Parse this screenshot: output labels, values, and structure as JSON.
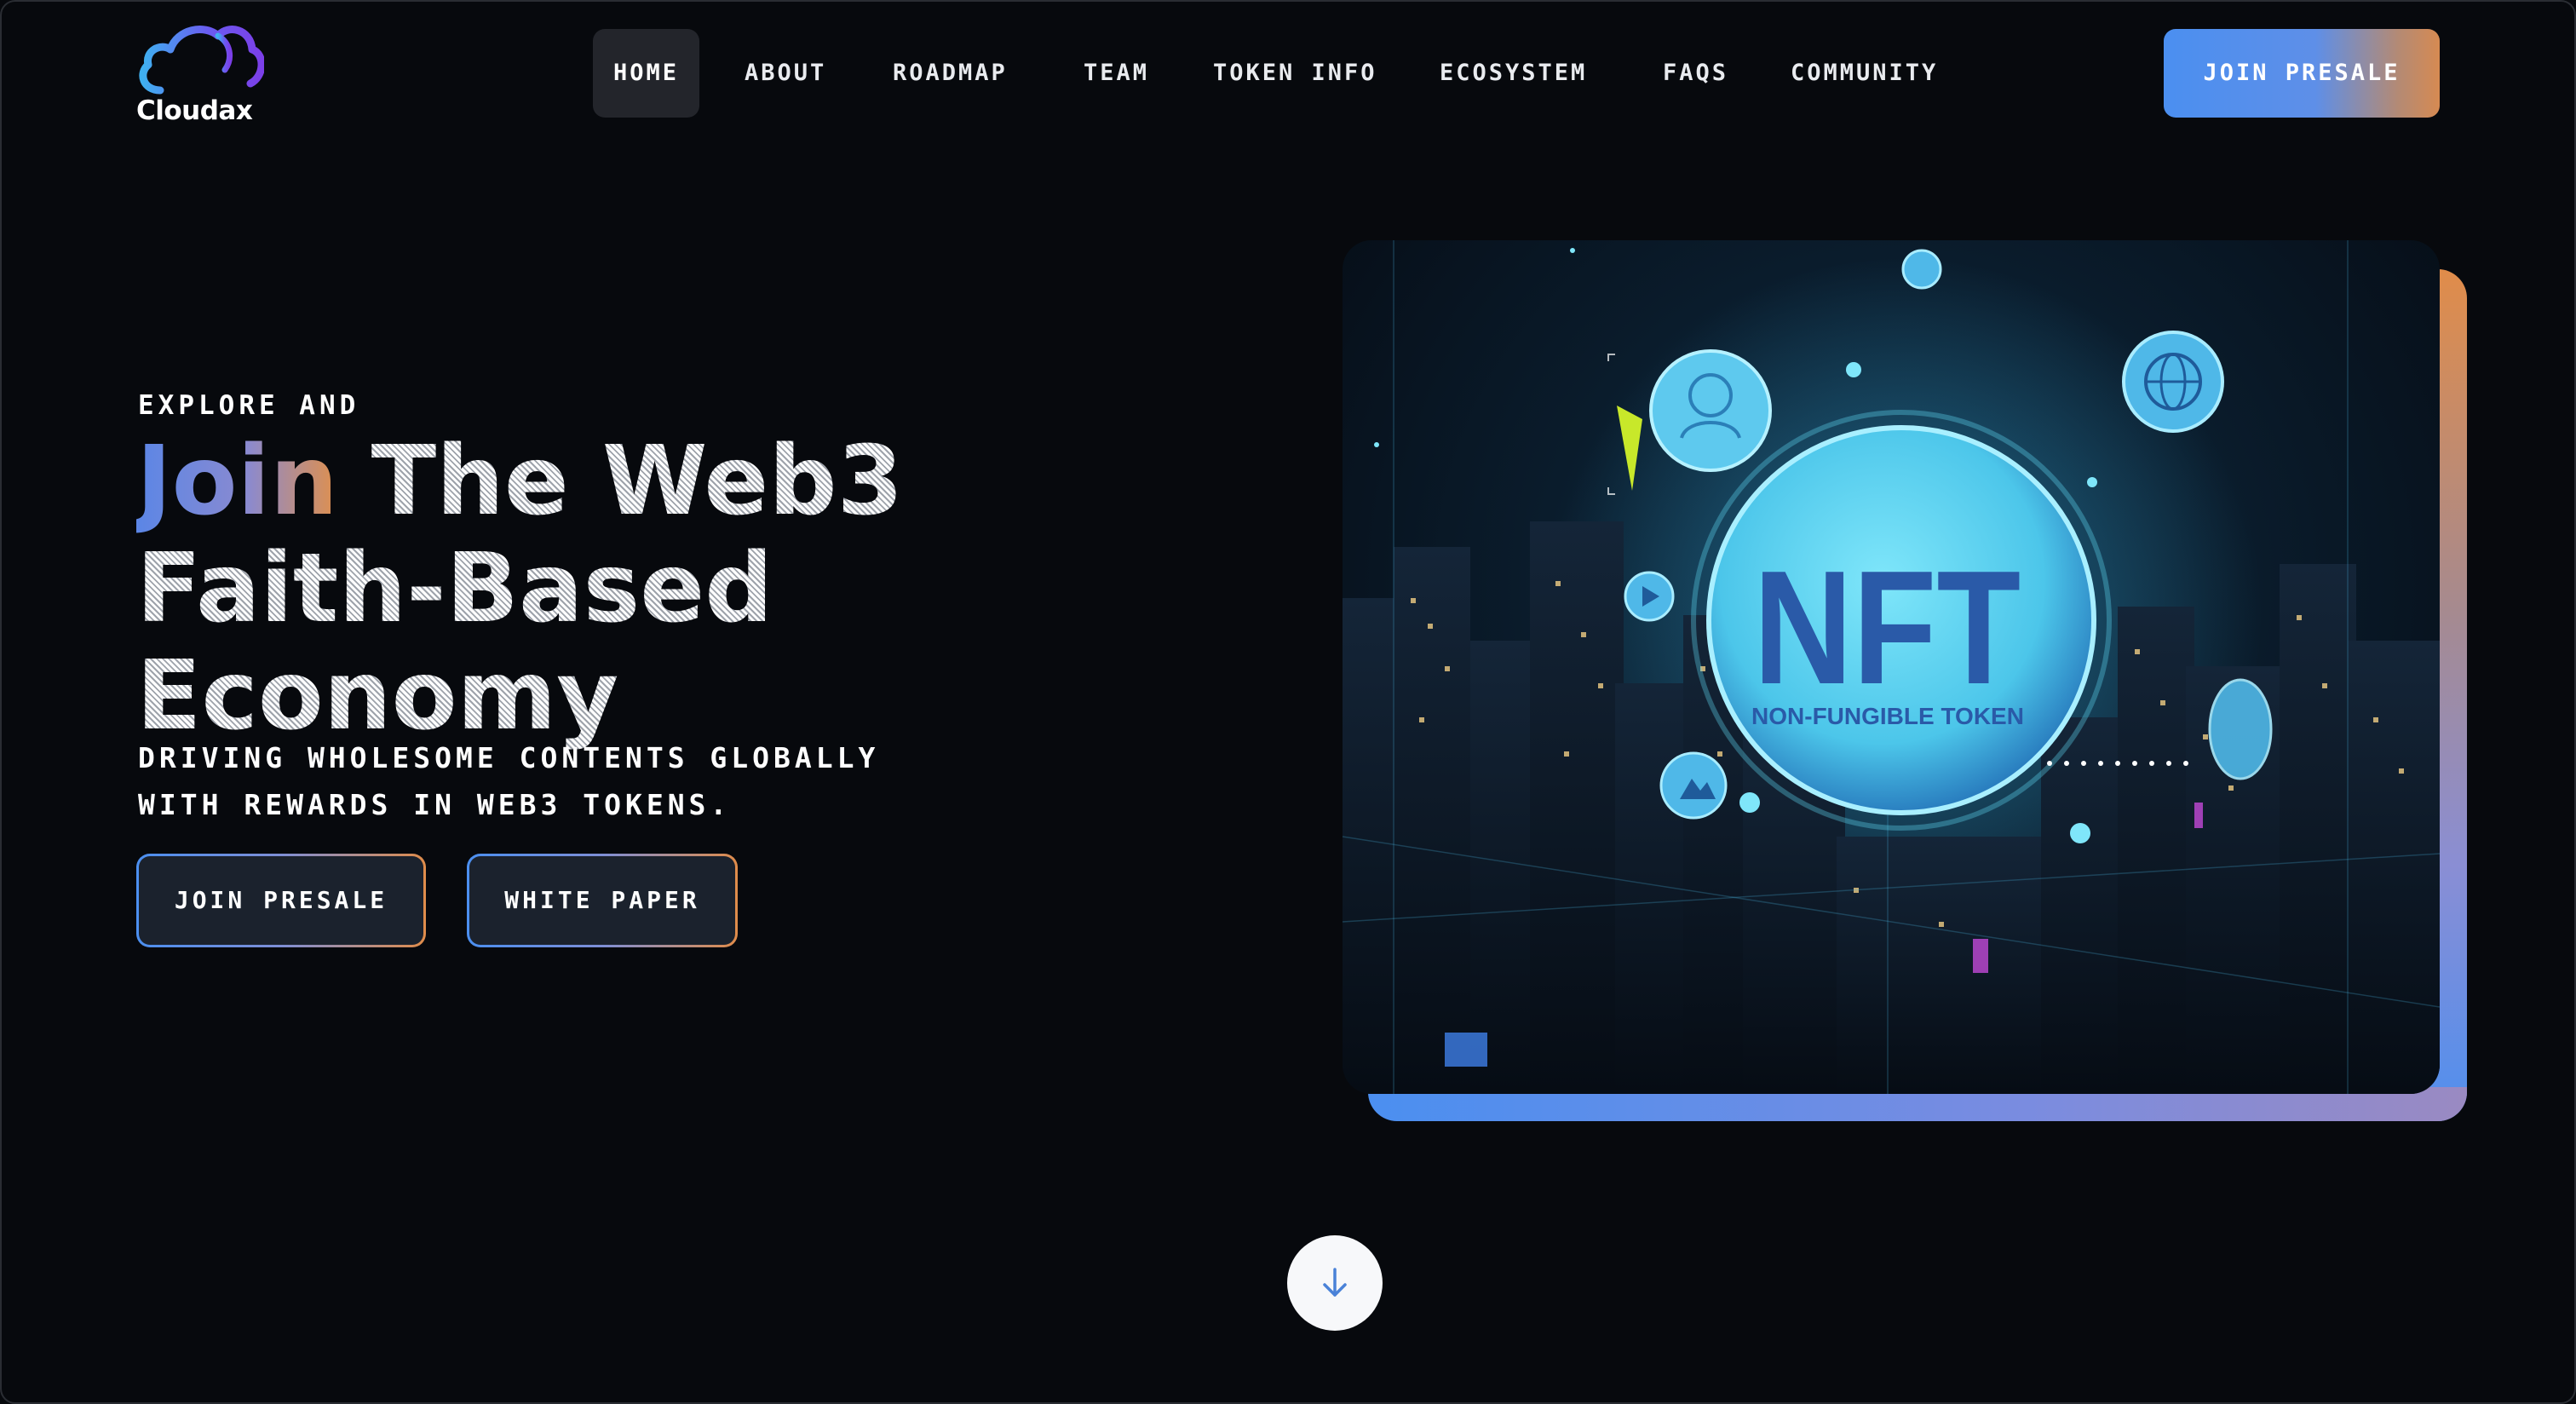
{
  "brand": {
    "name": "Cloudax",
    "logo_icon": "cloud-icon"
  },
  "nav": {
    "items": [
      {
        "label": "HOME",
        "active": true
      },
      {
        "label": "ABOUT"
      },
      {
        "label": "ROADMAP"
      },
      {
        "label": "TEAM"
      },
      {
        "label": "TOKEN INFO"
      },
      {
        "label": "ECOSYSTEM"
      },
      {
        "label": "FAQS"
      },
      {
        "label": "COMMUNITY"
      }
    ],
    "cta_label": "JOIN PRESALE"
  },
  "hero": {
    "eyebrow": "EXPLORE AND",
    "headline_highlight": "Join",
    "headline_rest_line1": "The Web3",
    "headline_line2": "Faith-Based",
    "headline_line3": "Economy",
    "subtext": "DRIVING WHOLESOME CONTENTS GLOBALLY WITH REWARDS IN WEB3 TOKENS.",
    "primary_button": "JOIN PRESALE",
    "secondary_button": "WHITE PAPER",
    "image": {
      "title": "NFT",
      "subtitle": "NON-FUNGIBLE TOKEN"
    }
  },
  "scroll": {
    "icon": "arrow-down-icon"
  },
  "colors": {
    "background": "#07090d",
    "accent_blue": "#4b8ff0",
    "accent_orange": "#e08c4a",
    "nft_cyan": "#5fd6f2"
  }
}
